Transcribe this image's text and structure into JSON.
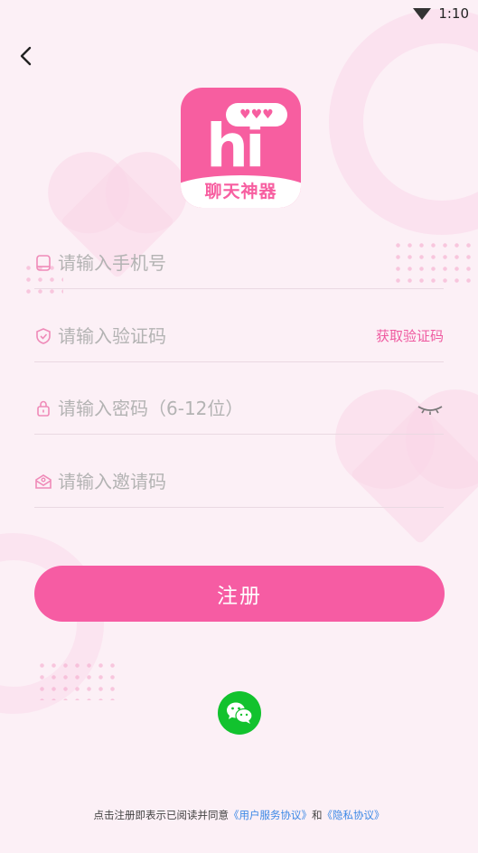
{
  "status_bar": {
    "time": "1:10"
  },
  "logo": {
    "caption": "聊天神器",
    "letters": "hi",
    "bubble_hearts": "♥♥♥"
  },
  "form": {
    "phone_placeholder": "请输入手机号",
    "code_placeholder": "请输入验证码",
    "get_code_label": "获取验证码",
    "password_placeholder": "请输入密码（6-12位）",
    "invite_placeholder": "请输入邀请码"
  },
  "register_label": "注册",
  "agreement": {
    "prefix": "点击注册即表示已阅读并同意",
    "user_service": "《用户服务协议》",
    "and": "和",
    "privacy": "《隐私协议》"
  },
  "colors": {
    "accent": "#f65ca3",
    "link": "#3b88e6",
    "wechat": "#12c22e"
  }
}
